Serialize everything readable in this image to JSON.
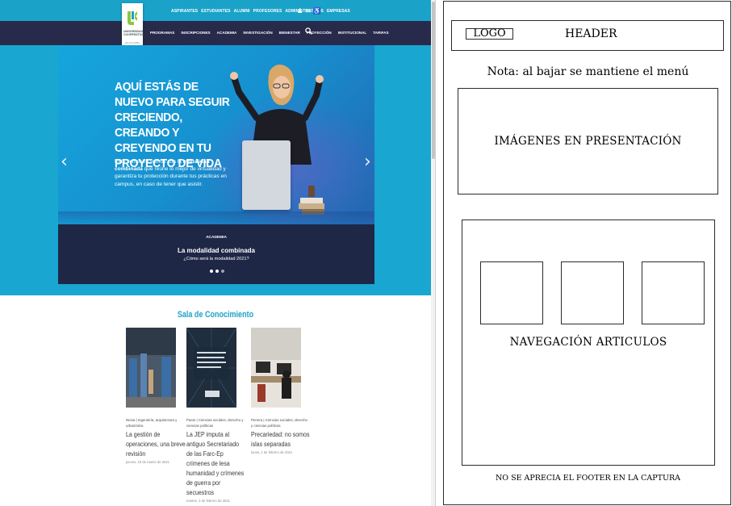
{
  "website": {
    "top_links": [
      "ASPIRANTES",
      "ESTUDIANTES",
      "ALUMNI",
      "PROFESORES",
      "ADMINISTRATIVOS",
      "EMPRESAS"
    ],
    "logo_text": "UNIVERSIDAD COOPERATIVA",
    "logo_sub": "DE COLOMBIA",
    "nav_links": [
      "PROGRAMAS",
      "INSCRIPCIONES",
      "ACADEMIA",
      "INVESTIGACIÓN",
      "BIENESTAR",
      "PROYECCIÓN",
      "INSTITUCIONAL",
      "TARIFAS"
    ],
    "hero": {
      "headline": "AQUÍ ESTÁS DE NUEVO PARA SEGUIR CRECIENDO, CREANDO Y CREYENDO EN TU PROYECTO DE VIDA",
      "copy_before": "Este semestre vamos con la ",
      "copy_bold": "modalidad combinada",
      "copy_after": " que reúne lo mejor de virtualidad y garantiza tu protección durante tus prácticas en campus, en caso de tener que asistir.",
      "tag": "ACADEMIA",
      "info_title": "La modalidad combinada",
      "info_subtitle": "¿Cómo será la modalidad 2021?",
      "prev_arrow": "‹",
      "next_arrow": "›"
    },
    "section_title": "Sala de Conocimiento",
    "articles": [
      {
        "meta": "Neiva | Ingeniería, arquitectura y urbanística",
        "title": "La gestión de operaciones, una breve revisión",
        "date": "jueves, 18 de marzo de 2021"
      },
      {
        "meta": "Pasto | Ciencias sociales, derecho y ciencias políticas",
        "title": "La JEP imputa al antiguo Secretariado de las Farc-Ep crímenes de lesa humanidad y crímenes de guerra por secuestros",
        "date": "martes, 2 de febrero de 2021"
      },
      {
        "meta": "Pereira | Ciencias sociales, derecho y ciencias políticas",
        "title": "Precariedad: no somos islas separadas",
        "date": "lunes, 1 de febrero de 2021"
      }
    ],
    "colors": {
      "brand_cyan": "#1aa2c9",
      "nav_dark": "#272a4a",
      "accent_green": "#8cc63f"
    }
  },
  "wireframe": {
    "logo_label": "LOGO",
    "header_label": "HEADER",
    "note": "Nota: al bajar se mantiene el menú",
    "slider_label": "IMÁGENES EN PRESENTACIÓN",
    "nav_label": "NAVEGACIÓN  ARTICULOS",
    "footer_note": "NO SE APRECIA EL FOOTER EN LA CAPTURA"
  }
}
